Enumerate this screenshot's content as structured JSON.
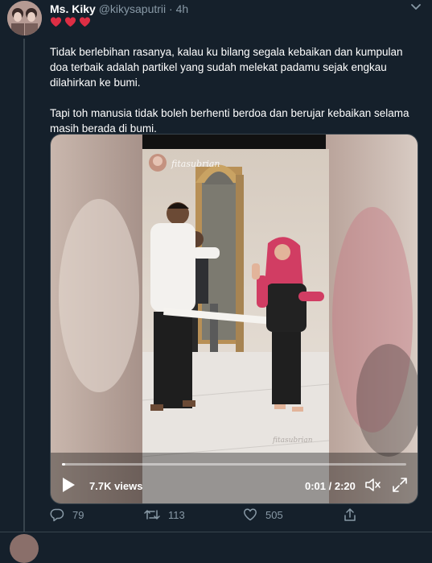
{
  "tweet": {
    "name": "Ms. Kiky",
    "handle": "@kikysaputrii",
    "separator": "·",
    "time": "4h",
    "hearts": [
      "♥",
      "♥",
      "♥"
    ],
    "paragraph_1": "Tidak berlebihan rasanya, kalau ku bilang segala kebaikan dan kumpulan doa terbaik adalah partikel yang sudah melekat padamu sejak engkau dilahirkan ke bumi.",
    "paragraph_2": "Tapi toh manusia tidak boleh berhenti berdoa dan berujar kebaikan selama masih berada di bumi."
  },
  "video": {
    "watermark_top": "fitasubrian",
    "watermark_bottom": "fitasubrian",
    "views": "7.7K views",
    "current_time": "0:01",
    "time_separator": " / ",
    "duration": "2:20",
    "progress_fraction": 0.01
  },
  "actions": {
    "replies": "79",
    "retweets": "113",
    "likes": "505"
  },
  "colors": {
    "background": "#15202b",
    "muted": "#8899a6",
    "heart": "#e0245e",
    "border": "#38444d"
  },
  "icons": {
    "caret": "chevron-down-icon",
    "play": "play-icon",
    "volume": "volume-icon",
    "fullscreen": "fullscreen-icon",
    "reply": "reply-icon",
    "retweet": "retweet-icon",
    "like": "heart-icon",
    "share": "share-icon"
  }
}
